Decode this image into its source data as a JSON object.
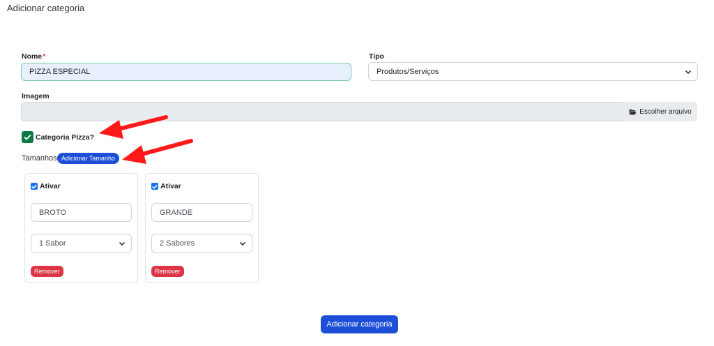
{
  "page": {
    "title": "Adicionar categoria"
  },
  "form": {
    "nome": {
      "label": "Nome",
      "required_mark": "*",
      "value": "PIZZA ESPECIAL"
    },
    "tipo": {
      "label": "Tipo",
      "selected": "Produtos/Serviços"
    },
    "imagem": {
      "label": "Imagem",
      "file_button": "Escolher arquivo"
    },
    "categoria_pizza": {
      "label": "Categoria Pizza?",
      "checked": true
    },
    "tamanhos": {
      "label": "Tamanhos",
      "add_button": "Adicionar Tamanho",
      "items": [
        {
          "ativar_label": "Ativar",
          "ativo": true,
          "name": "BROTO",
          "sabores": "1 Sabor",
          "remove_label": "Remover"
        },
        {
          "ativar_label": "Ativar",
          "ativo": true,
          "name": "GRANDE",
          "sabores": "2 Sabores",
          "remove_label": "Remover"
        }
      ]
    },
    "submit_label": "Adicionar categoria"
  },
  "colors": {
    "primary": "#1d4ed8",
    "danger": "#dc3545",
    "checkbox_green": "#0e7a43",
    "arrow_red": "#ff1a1a"
  },
  "icons": {
    "file_button": "folder-open-icon",
    "select": "chevron-down-icon",
    "check": "check-icon"
  }
}
